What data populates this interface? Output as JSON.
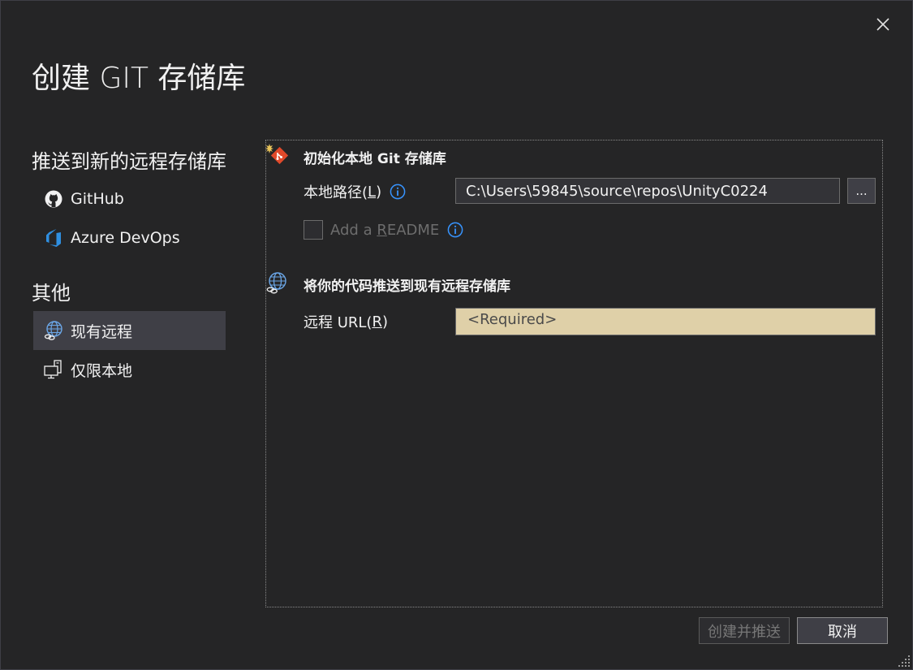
{
  "dialog": {
    "title": "创建 GIT 存储库",
    "close_icon": "close-icon"
  },
  "sidebar": {
    "push_heading": "推送到新的远程存储库",
    "push_items": [
      {
        "label": "GitHub",
        "icon": "github-icon"
      },
      {
        "label": "Azure DevOps",
        "icon": "azure-devops-icon"
      }
    ],
    "other_heading": "其他",
    "other_items": [
      {
        "label": "现有远程",
        "icon": "globe-link-icon",
        "selected": true
      },
      {
        "label": "仅限本地",
        "icon": "local-computer-icon",
        "selected": false
      }
    ]
  },
  "init_group": {
    "title": "初始化本地 Git 存储库",
    "icon": "new-git-repo-icon",
    "local_path_label": "本地路径(",
    "local_path_mnemonic": "L",
    "local_path_label_end": ")",
    "local_path_value": "C:\\Users\\59845\\source\\repos\\UnityC0224",
    "browse_label": "...",
    "readme_label_pre": "Add a ",
    "readme_mnemonic": "R",
    "readme_label_post": "EADME",
    "readme_checked": false
  },
  "remote_group": {
    "title": "将你的代码推送到现有远程存储库",
    "icon": "globe-link-icon",
    "url_label": "远程 URL(",
    "url_mnemonic": "R",
    "url_label_end": ")",
    "url_placeholder": "<Required>"
  },
  "footer": {
    "create_push_label": "创建并推送",
    "cancel_label": "取消"
  },
  "colors": {
    "background": "#252526",
    "selected_item": "#3f3f46",
    "required_field": "#dfd0a8",
    "info_blue": "#3794ff",
    "git_red": "#e04a2b"
  }
}
